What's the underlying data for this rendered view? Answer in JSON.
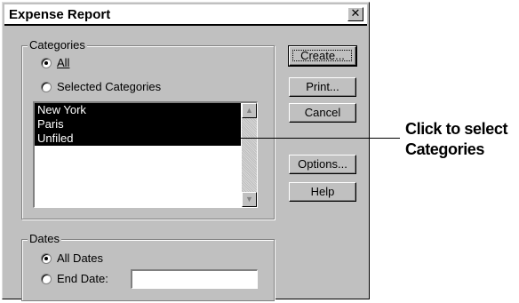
{
  "dialog": {
    "title": "Expense Report",
    "close_label": "✕"
  },
  "categories": {
    "legend": "Categories",
    "radio_all": "All",
    "radio_selected": "Selected Categories",
    "selected_option": "All",
    "items": [
      "New York",
      "Paris",
      "Unfiled"
    ],
    "scroll_up_label": "▲",
    "scroll_down_label": "▼"
  },
  "dates": {
    "legend": "Dates",
    "radio_all_dates": "All Dates",
    "radio_end_date": "End Date:",
    "selected_option": "All Dates",
    "end_date_value": ""
  },
  "buttons": {
    "create": "Create...",
    "print": "Print...",
    "cancel": "Cancel",
    "options": "Options...",
    "help": "Help"
  },
  "callout": {
    "line1": "Click to select",
    "line2": "Categories"
  }
}
